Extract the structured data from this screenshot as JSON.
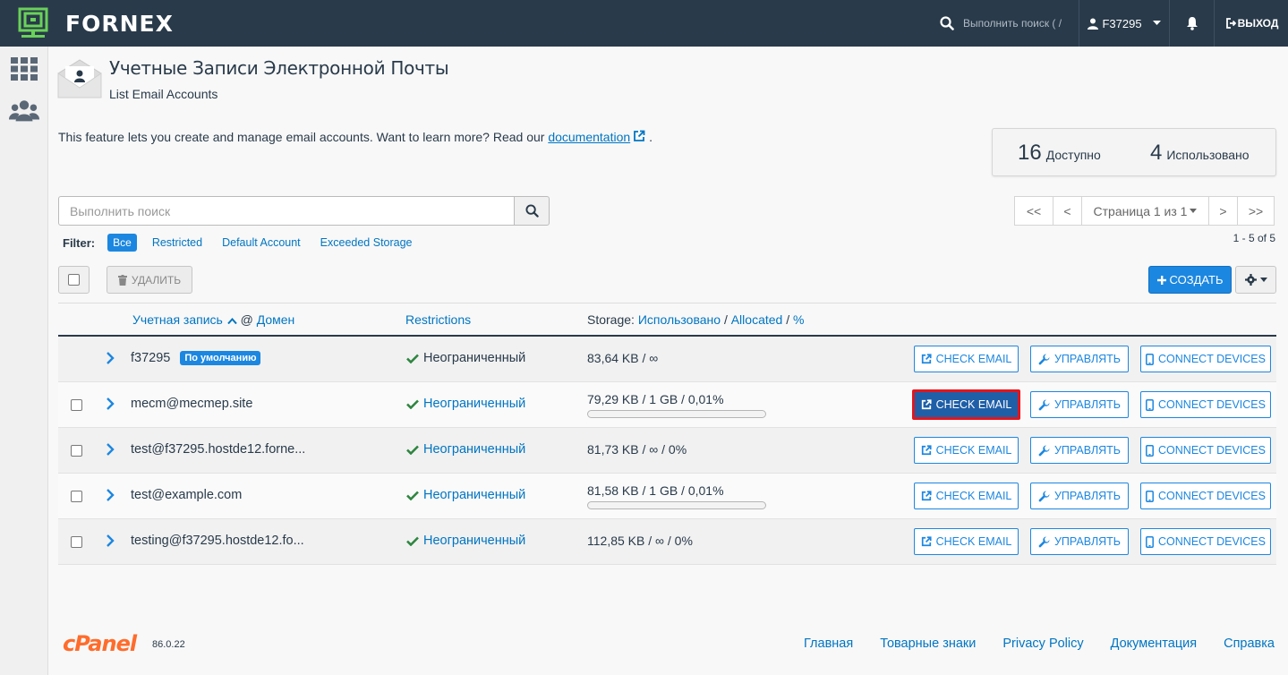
{
  "brand": {
    "name": "FORNEX"
  },
  "topbar": {
    "search_placeholder": "Выполнить поиск ( /",
    "username": "F37295",
    "logout_label": "ВЫХОД"
  },
  "header": {
    "title": "Учетные Записи Электронной Почты",
    "subtitle": "List Email Accounts"
  },
  "intro": {
    "text": "This feature lets you create and manage email accounts. Want to learn more? Read our",
    "link_label": "documentation",
    "after": "."
  },
  "stats": {
    "available_count": "16",
    "available_label": "Доступно",
    "used_count": "4",
    "used_label": "Использовано"
  },
  "search": {
    "placeholder": "Выполнить поиск"
  },
  "filter": {
    "label": "Filter:",
    "options": [
      "Все",
      "Restricted",
      "Default Account",
      "Exceeded Storage"
    ]
  },
  "pagination": {
    "first": "<<",
    "prev": "<",
    "page_label": "Страница 1 из 1",
    "next": ">",
    "last": ">>",
    "count_text": "1 - 5 of 5"
  },
  "toolbar": {
    "delete_label": "УДАЛИТЬ",
    "create_label": "СОЗДАТЬ"
  },
  "table": {
    "header": {
      "account": "Учетная запись",
      "at": "@",
      "domain": "Домен",
      "restrictions": "Restrictions",
      "storage_prefix": "Storage:",
      "storage_used": "Использовано",
      "sep1": "/",
      "storage_allocated": "Allocated",
      "sep2": "/",
      "storage_pct": "%"
    },
    "rows": [
      {
        "account": "f37295",
        "badge": "По умолчанию",
        "restriction": "Неограниченный",
        "storage": "83,64 KB / ∞",
        "has_bar": false,
        "usage_fraction": 0,
        "selectable": false,
        "highlight": false
      },
      {
        "account": "mecm@mecmep.site",
        "badge": "",
        "restriction": "Неограниченный",
        "storage": "79,29 KB / 1 GB / 0,01%",
        "has_bar": true,
        "usage_fraction": 0.0001,
        "selectable": true,
        "highlight": true
      },
      {
        "account": "test@f37295.hostde12.forne...",
        "badge": "",
        "restriction": "Неограниченный",
        "storage": "81,73 KB / ∞ / 0%",
        "has_bar": false,
        "usage_fraction": 0,
        "selectable": true,
        "highlight": false
      },
      {
        "account": "test@example.com",
        "badge": "",
        "restriction": "Неограниченный",
        "storage": "81,58 KB / 1 GB / 0,01%",
        "has_bar": true,
        "usage_fraction": 0.0001,
        "selectable": true,
        "highlight": false
      },
      {
        "account": "testing@f37295.hostde12.fo...",
        "badge": "",
        "restriction": "Неограниченный",
        "storage": "112,85 KB / ∞ / 0%",
        "has_bar": false,
        "usage_fraction": 0,
        "selectable": true,
        "highlight": false
      }
    ],
    "actions": {
      "check_email": "CHECK EMAIL",
      "manage": "УПРАВЛЯТЬ",
      "connect_devices": "CONNECT DEVICES"
    }
  },
  "footer": {
    "logo_text": "cPanel",
    "version": "86.0.22",
    "links": [
      "Главная",
      "Товарные знаки",
      "Privacy Policy",
      "Документация",
      "Справка"
    ]
  },
  "colors": {
    "topbar": "#293a4a",
    "accent": "#1c87e0",
    "link": "#0075c2",
    "success": "#2e8540",
    "highlight_border": "#e0161e",
    "logo_green": "#6ad15a",
    "cpanel_orange": "#ff6c2c"
  }
}
